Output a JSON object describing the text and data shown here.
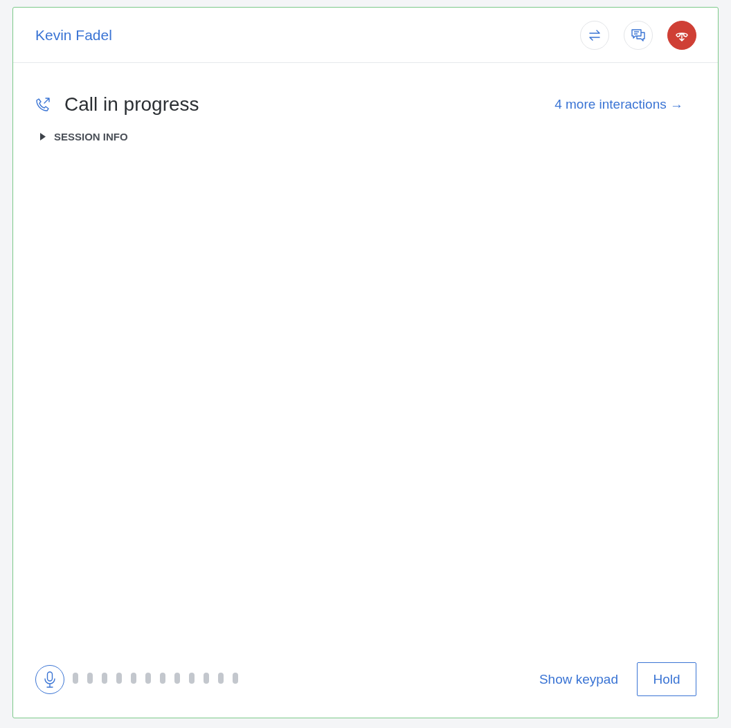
{
  "header": {
    "contact_name": "Kevin Fadel"
  },
  "call": {
    "title": "Call in progress",
    "more_link": "4 more interactions →"
  },
  "session_info": {
    "label": "SESSION INFO",
    "expanded": false
  },
  "footer": {
    "keypad_link": "Show keypad",
    "hold_button": "Hold"
  }
}
